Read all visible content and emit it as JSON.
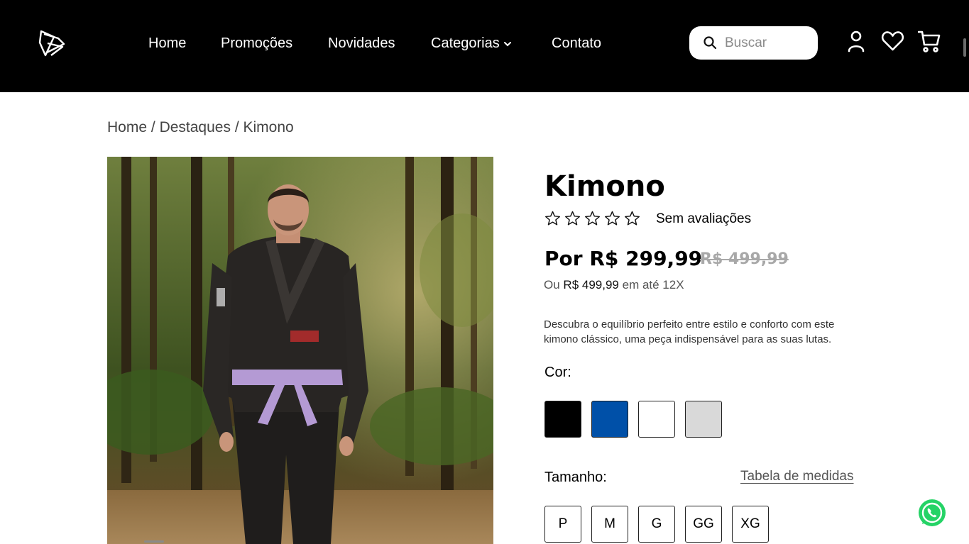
{
  "header": {
    "nav": [
      {
        "label": "Home"
      },
      {
        "label": "Promoções"
      },
      {
        "label": "Novidades"
      },
      {
        "label": "Categorias"
      },
      {
        "label": "Contato"
      }
    ],
    "search": {
      "placeholder": "Buscar",
      "value": ""
    },
    "icons": [
      "user-icon",
      "heart-icon",
      "cart-icon"
    ]
  },
  "breadcrumb": {
    "items": [
      "Home",
      "Destaques",
      "Kimono"
    ],
    "separator": "/"
  },
  "product": {
    "title": "Kimono",
    "rating": {
      "stars": 0,
      "max": 5,
      "label": "Sem avaliações"
    },
    "price": "Por R$ 299,99",
    "old_price": "R$ 499,99",
    "installments": {
      "prefix": "Ou",
      "amount": "R$ 499,99",
      "suffix": "em até 12X"
    },
    "description": "Descubra o equilíbrio perfeito entre estilo e conforto com este kimono clássico, uma peça indispensável para as suas lutas.",
    "color_label": "Cor:",
    "colors": [
      "#000000",
      "#0050a8",
      "#ffffff",
      "#d9d9d9"
    ],
    "size_label": "Tamanho:",
    "size_chart_label": "Tabela de medidas",
    "sizes": [
      "P",
      "M",
      "G",
      "GG",
      "XG"
    ]
  },
  "colors": {
    "header_bg": "#000000",
    "text": "#000000",
    "muted": "#a8a8a8",
    "whatsapp": "#25d366"
  }
}
